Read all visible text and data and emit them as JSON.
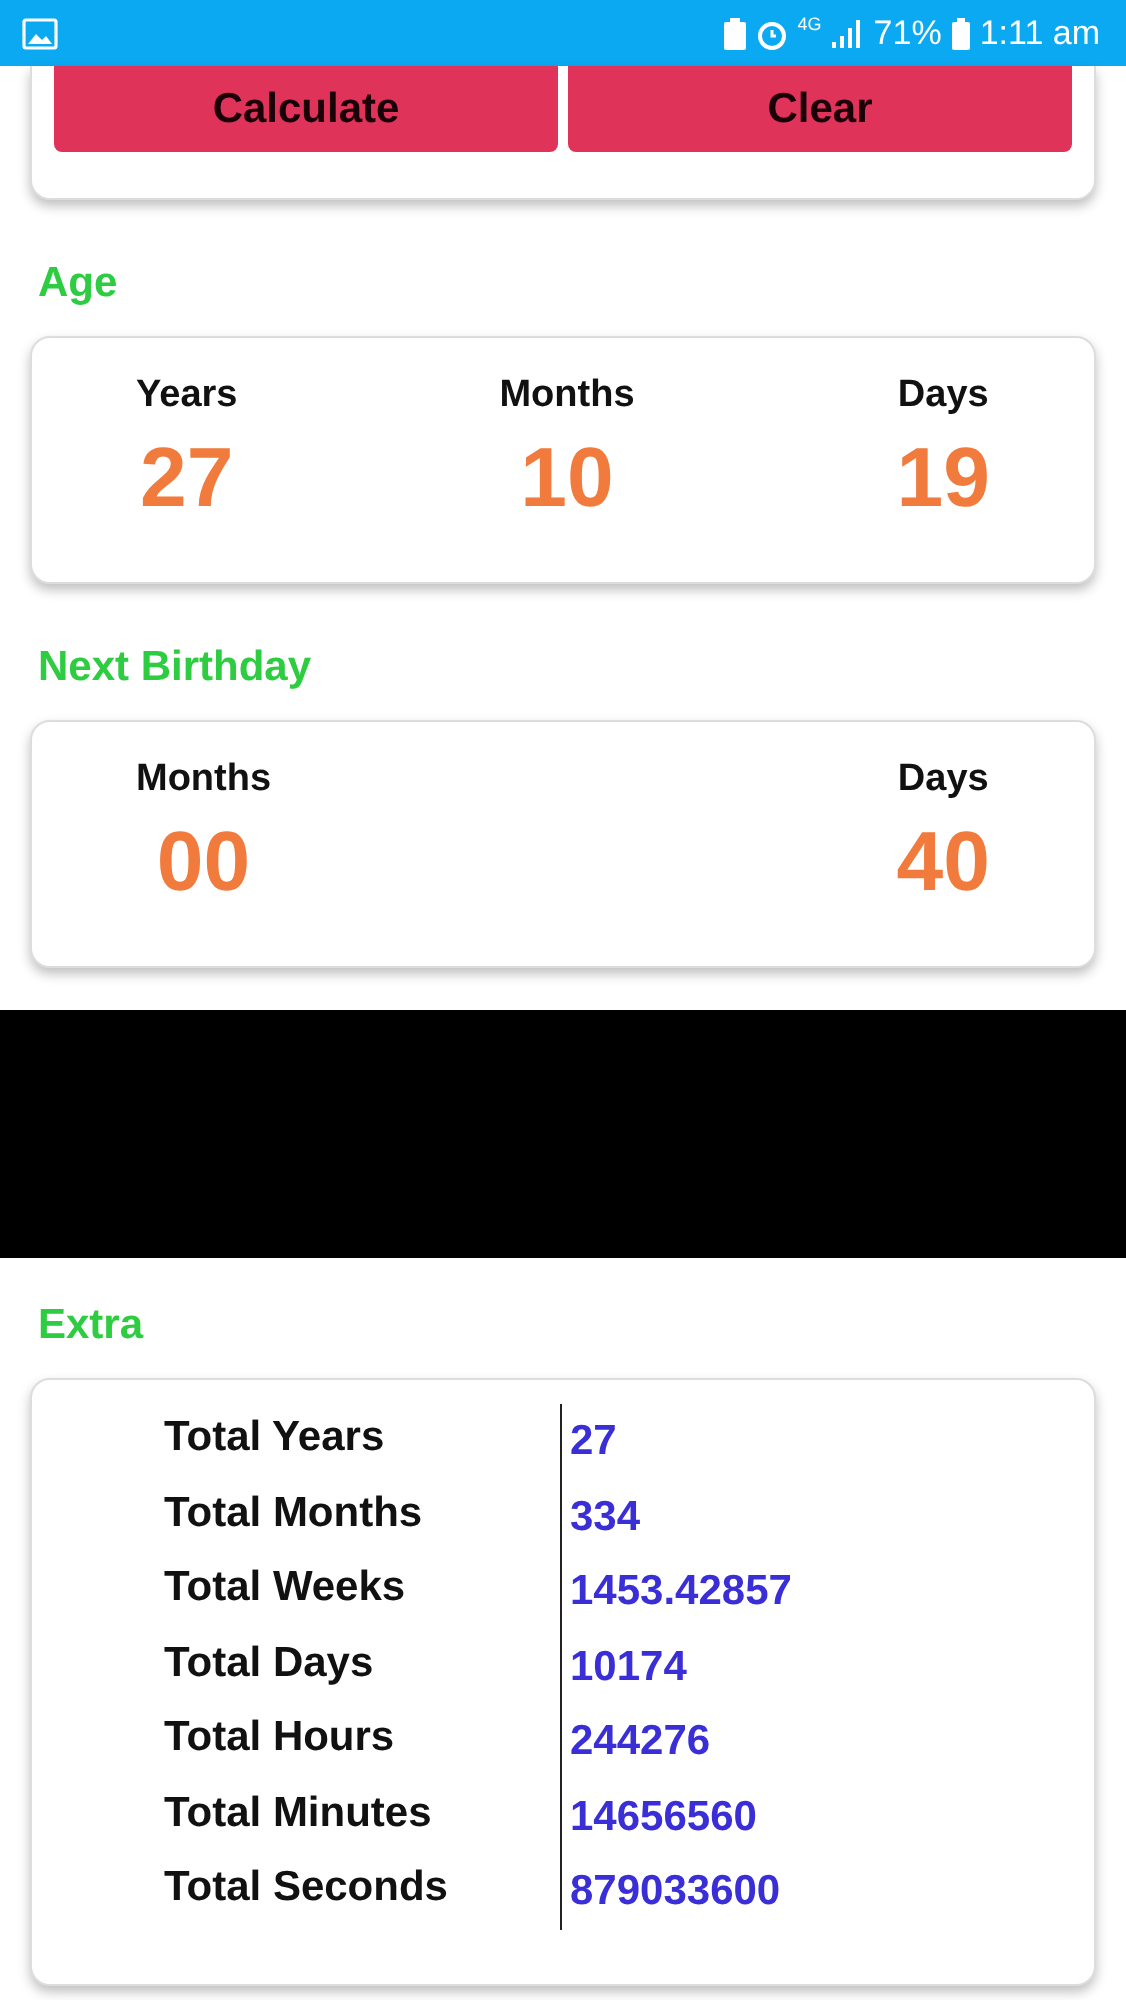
{
  "status_bar": {
    "battery": "71%",
    "network": "4G",
    "time": "1:11 am"
  },
  "buttons": [
    "Calculate",
    "Clear"
  ],
  "age": {
    "title": "Age",
    "fields": [
      {
        "label": "Years",
        "value": "27"
      },
      {
        "label": "Months",
        "value": "10"
      },
      {
        "label": "Days",
        "value": "19"
      }
    ]
  },
  "next_birthday": {
    "title": "Next Birthday",
    "fields": [
      {
        "label": "Months",
        "value": "00"
      },
      {
        "label": "Days",
        "value": "40"
      }
    ]
  },
  "extra": {
    "title": "Extra",
    "rows": [
      {
        "label": "Total Years",
        "value": "27"
      },
      {
        "label": "Total Months",
        "value": "334"
      },
      {
        "label": "Total Weeks",
        "value": "1453.42857"
      },
      {
        "label": "Total Days",
        "value": "10174"
      },
      {
        "label": "Total Hours",
        "value": "244276"
      },
      {
        "label": "Total Minutes",
        "value": "14656560"
      },
      {
        "label": "Total Seconds",
        "value": "879033600"
      }
    ]
  }
}
